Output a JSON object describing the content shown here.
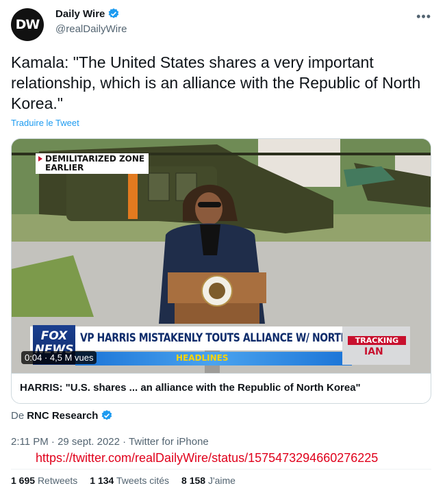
{
  "author": {
    "avatar_text": "DW",
    "display_name": "Daily Wire",
    "handle": "@realDailyWire",
    "verified": true
  },
  "more_icon": "more-options-icon",
  "tweet": {
    "text": "Kamala: \"The United States shares a very important relationship, which is an alliance with the Republic of North Korea.\"",
    "translate_label": "Traduire le Tweet"
  },
  "media": {
    "zone_tag_line1": "DEMILITARIZED ZONE",
    "zone_tag_line2": "EARLIER",
    "fox_logo_line1": "FOX",
    "fox_logo_line2": "NEWS",
    "chyron": "VP HARRIS MISTAKENLY TOUTS ALLIANCE W/ NORTH KOREA",
    "headlines": "HEADLINES",
    "tracking_label": "TRACKING",
    "tracking_name": "IAN",
    "time": "0:04",
    "views": "4,5 M vues",
    "badge": "0:04 · 4,5 M vues",
    "caption": "HARRIS: \"U.S. shares ... an alliance with the Republic of North Korea\""
  },
  "source": {
    "prefix": "De",
    "name": "RNC Research",
    "verified": true
  },
  "meta": {
    "line": "2:11 PM · 29 sept. 2022 · Twitter for iPhone"
  },
  "url_overlay": "https://twitter.com/realDailyWire/status/1575473294660276225",
  "stats": {
    "retweets_count": "1 695",
    "retweets_label": "Retweets",
    "quotes_count": "1 134",
    "quotes_label": "Tweets cités",
    "likes_count": "8 158",
    "likes_label": "J'aime"
  },
  "colors": {
    "link_blue": "#1d9bf0",
    "verified_blue": "#1d9bf0",
    "url_red": "#e0001b",
    "secondary_text": "#536471"
  }
}
